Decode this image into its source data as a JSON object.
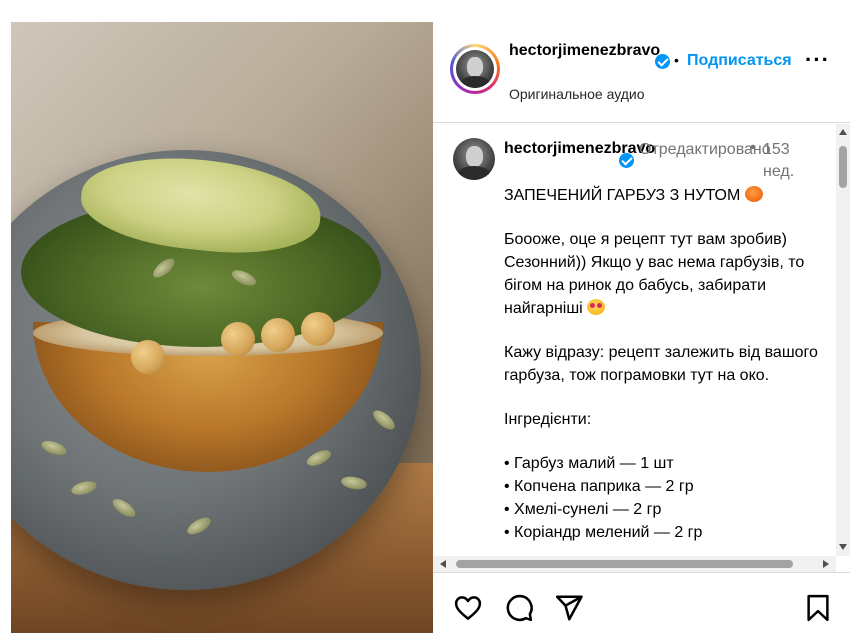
{
  "header": {
    "username": "hectorjimenezbravo",
    "separator": "•",
    "follow_label": "Подписаться",
    "audio_label": "Оригинальное аудио",
    "more_label": "···"
  },
  "caption": {
    "username": "hectorjimenezbravo",
    "edited_label": "Отредактировано",
    "separator": "•",
    "time": "153 нед.",
    "title": "ЗАПЕЧЕНИЙ ГАРБУЗ З НУТОМ",
    "para1": "Боооже, оце я рецепт тут вам зробив) Сезонний)) Якщо у вас нема гарбузів, то бігом на ринок до бабусь, забирати найгарніші",
    "para2": "Кажу відразу: рецепт залежить від вашого гарбуза, тож пограмовки тут на око.",
    "ingredients_heading": "Інгредієнти:",
    "ingredients": [
      "• Гарбуз малий — 1 шт",
      "• Копчена паприка — 2 гр",
      "• Хмелі-сунелі — 2 гр",
      "• Коріандр мелений — 2 гр"
    ]
  },
  "icons": {
    "like": "heart-icon",
    "comment": "comment-icon",
    "share": "share-icon",
    "save": "bookmark-icon",
    "verified": "verified-badge-icon",
    "title_emoji": "pumpkin-emoji",
    "para1_emoji": "heart-eyes-emoji"
  },
  "colors": {
    "accent": "#0095f6",
    "muted": "#737373",
    "border": "#dbdbdb"
  }
}
